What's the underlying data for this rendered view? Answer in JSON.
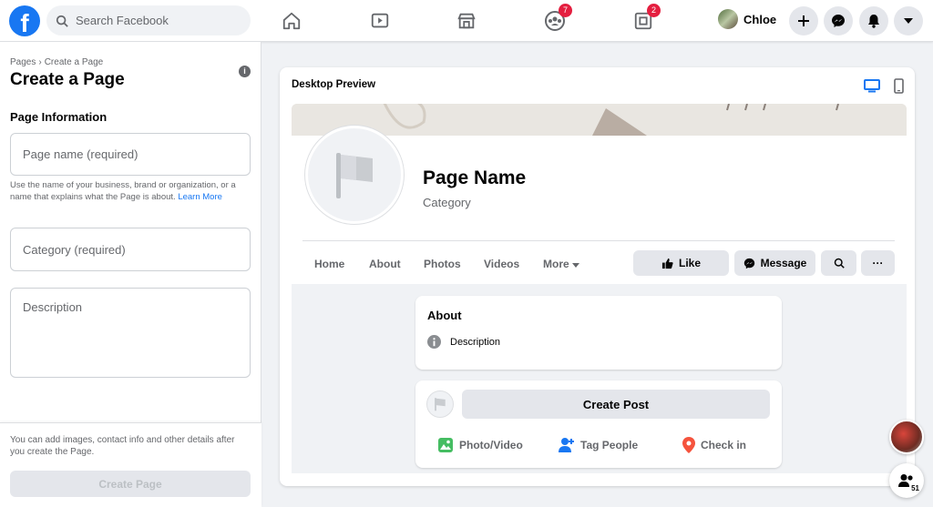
{
  "topbar": {
    "logo": "f",
    "search_placeholder": "Search Facebook",
    "groups_badge": "7",
    "gaming_badge": "2",
    "profile_name": "Chloe"
  },
  "left_panel": {
    "breadcrumb": [
      "Pages",
      "Create a Page"
    ],
    "breadcrumb_sep": "›",
    "title": "Create a Page",
    "info_glyph": "i",
    "section_heading": "Page Information",
    "page_name_placeholder": "Page name (required)",
    "helper_text": "Use the name of your business, brand or organization, or a name that explains what the Page is about.",
    "helper_link": "Learn More",
    "category_placeholder": "Category (required)",
    "description_placeholder": "Description",
    "footer_note": "You can add images, contact info and other details after you create the Page.",
    "create_button": "Create Page"
  },
  "preview": {
    "title": "Desktop Preview",
    "page_name": "Page Name",
    "category": "Category",
    "tabs": [
      "Home",
      "About",
      "Photos",
      "Videos",
      "More"
    ],
    "like_label": "Like",
    "message_label": "Message",
    "more_actions_label": "···",
    "about_heading": "About",
    "about_description": "Description",
    "create_post_label": "Create Post",
    "actions": [
      "Photo/Video",
      "Tag People",
      "Check in"
    ]
  },
  "contacts": {
    "online_count": "51"
  },
  "colors": {
    "brand_blue": "#1877f2",
    "badge_red": "#e41e3f",
    "photo_green": "#45bd62",
    "checkin_red": "#f5533d"
  }
}
